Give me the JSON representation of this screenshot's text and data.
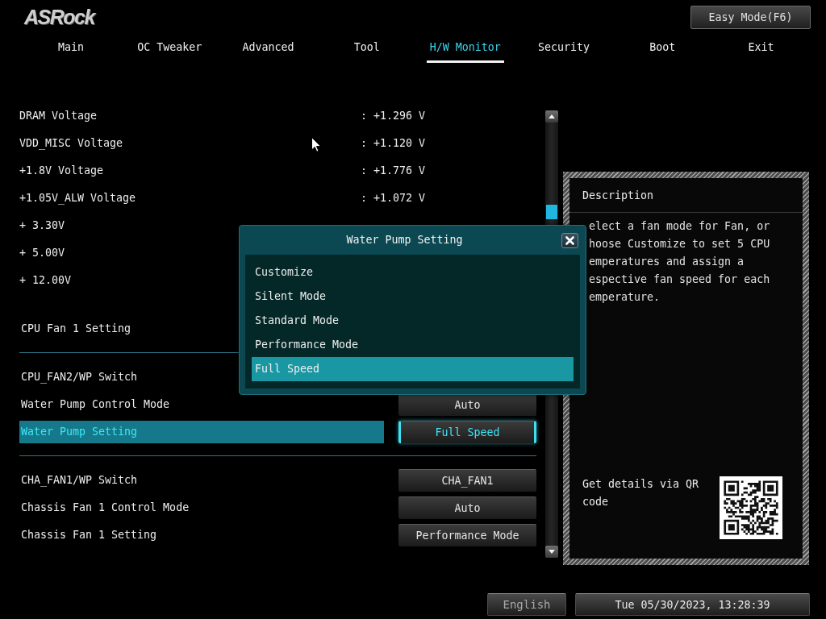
{
  "header": {
    "logo": "ASRock",
    "easy_mode_button": "Easy Mode(F6)"
  },
  "tabs": [
    {
      "label": "Main",
      "selected": false
    },
    {
      "label": "OC Tweaker",
      "selected": false
    },
    {
      "label": "Advanced",
      "selected": false
    },
    {
      "label": "Tool",
      "selected": false
    },
    {
      "label": "H/W Monitor",
      "selected": true
    },
    {
      "label": "Security",
      "selected": false
    },
    {
      "label": "Boot",
      "selected": false
    },
    {
      "label": "Exit",
      "selected": false
    }
  ],
  "readings": [
    {
      "label": "DRAM Voltage",
      "value": ": +1.296 V"
    },
    {
      "label": "VDD_MISC Voltage",
      "value": ": +1.120 V"
    },
    {
      "label": "+1.8V Voltage",
      "value": ": +1.776 V"
    },
    {
      "label": "+1.05V_ALW Voltage",
      "value": ": +1.072 V"
    },
    {
      "label": "+ 3.30V"
    },
    {
      "label": "+ 5.00V"
    },
    {
      "label": "+ 12.00V"
    }
  ],
  "fan_groups": [
    {
      "items": [
        {
          "label": "CPU Fan 1 Setting",
          "selected": false
        }
      ]
    },
    {
      "items": [
        {
          "label": "CPU_FAN2/WP Switch",
          "selected": false
        },
        {
          "label": "Water Pump Control Mode",
          "value": "Auto",
          "selected": false
        },
        {
          "label": "Water Pump Setting",
          "value": "Full Speed",
          "selected": true
        }
      ]
    },
    {
      "items": [
        {
          "label": "CHA_FAN1/WP Switch",
          "value": "CHA_FAN1",
          "selected": false
        },
        {
          "label": "Chassis Fan 1 Control Mode",
          "value": "Auto",
          "selected": false
        },
        {
          "label": "Chassis Fan 1 Setting",
          "value": "Performance Mode",
          "selected": false
        }
      ]
    }
  ],
  "description": {
    "title": "Description",
    "lines": [
      "elect a fan mode for Fan, or",
      "hoose Customize to set 5 CPU",
      "emperatures and assign a",
      "espective fan speed for each",
      "emperature."
    ],
    "qr_caption": "Get details via QR code"
  },
  "popup": {
    "title": "Water Pump Setting",
    "options": [
      {
        "label": "Customize",
        "selected": false
      },
      {
        "label": "Silent Mode",
        "selected": false
      },
      {
        "label": "Standard Mode",
        "selected": false
      },
      {
        "label": "Performance Mode",
        "selected": false
      },
      {
        "label": "Full Speed",
        "selected": true
      }
    ]
  },
  "footer": {
    "language": "English",
    "datetime": "Tue 05/30/2023, 13:28:39"
  }
}
